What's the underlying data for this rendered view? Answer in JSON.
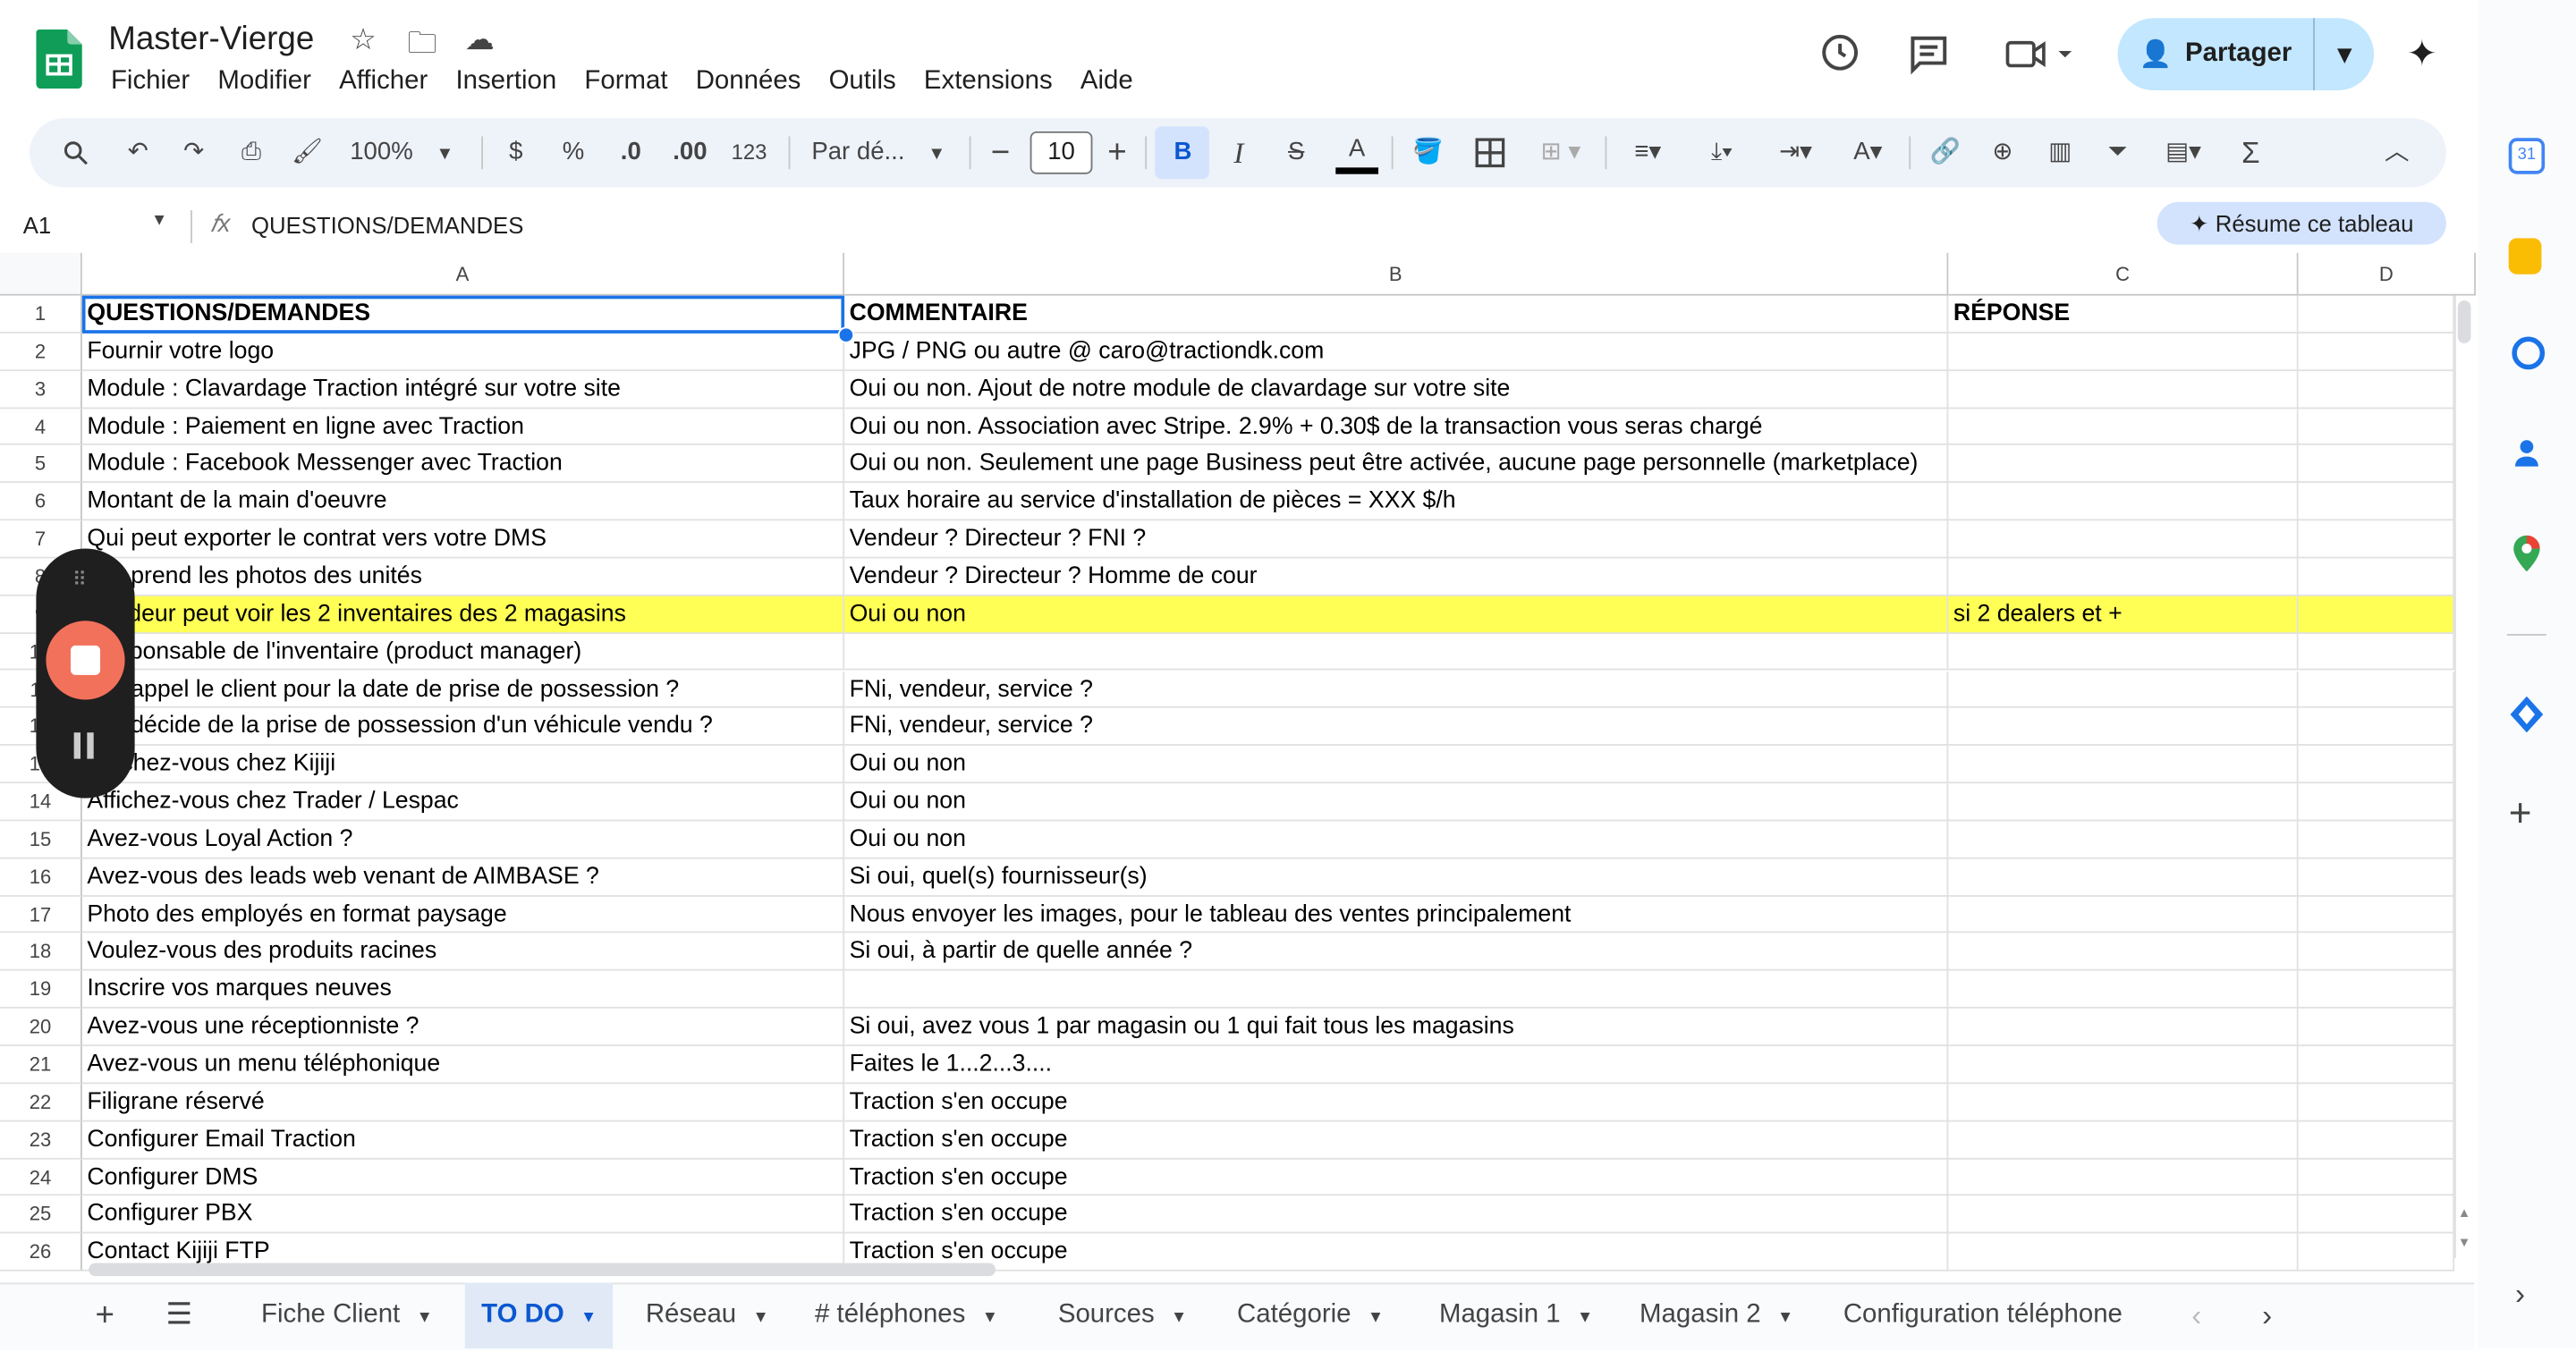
{
  "app": {
    "doc_title": "Master-Vierge",
    "menu": [
      "Fichier",
      "Modifier",
      "Afficher",
      "Insertion",
      "Format",
      "Données",
      "Outils",
      "Extensions",
      "Aide"
    ],
    "share_label": "Partager"
  },
  "toolbar": {
    "zoom": "100%",
    "currency": "$",
    "percent": "%",
    "dec_minus": ".0",
    "dec_plus": ".00",
    "format_123": "123",
    "font": "Par dé...",
    "font_size": "10"
  },
  "formula_bar": {
    "cell_ref": "A1",
    "content": "QUESTIONS/DEMANDES",
    "summarize": "Résume ce tableau"
  },
  "columns": [
    "A",
    "B",
    "C",
    "D"
  ],
  "rows": [
    {
      "n": "1",
      "a": "QUESTIONS/DEMANDES",
      "b": "COMMENTAIRE",
      "c": "RÉPONSE"
    },
    {
      "n": "2",
      "a": "Fournir votre logo",
      "b": "JPG / PNG ou autre @ caro@tractiondk.com",
      "c": ""
    },
    {
      "n": "3",
      "a": "Module : Clavardage Traction intégré sur votre site",
      "b": "Oui ou non. Ajout de notre module de clavardage sur votre site",
      "c": ""
    },
    {
      "n": "4",
      "a": "Module : Paiement en ligne avec Traction",
      "b": "Oui ou non. Association avec Stripe. 2.9% + 0.30$ de la transaction vous seras chargé",
      "c": ""
    },
    {
      "n": "5",
      "a": "Module : Facebook Messenger avec Traction",
      "b": "Oui ou non. Seulement une page Business peut être activée, aucune page personnelle (marketplace)",
      "c": ""
    },
    {
      "n": "6",
      "a": "Montant de la main d'oeuvre",
      "b": "Taux horaire au service d'installation de pièces = XXX $/h",
      "c": ""
    },
    {
      "n": "7",
      "a": "Qui peut exporter le contrat vers votre DMS",
      "b": "Vendeur ? Directeur ? FNI ?",
      "c": ""
    },
    {
      "n": "8",
      "a": "Qui prend les photos des unités",
      "b": "Vendeur ? Directeur ? Homme de cour",
      "c": ""
    },
    {
      "n": "9",
      "a": "Vendeur peut voir les 2 inventaires des 2 magasins",
      "b": "Oui ou non",
      "c": "si 2 dealers et +"
    },
    {
      "n": "10",
      "a": "Responsable de l'inventaire (product manager)",
      "b": "",
      "c": ""
    },
    {
      "n": "11",
      "a": "Qui appel le client pour la date de prise de possession ?",
      "b": "FNi, vendeur, service ?",
      "c": ""
    },
    {
      "n": "12",
      "a": "Qui décide de la prise de possession d'un véhicule vendu ?",
      "b": "FNi, vendeur, service ?",
      "c": ""
    },
    {
      "n": "13",
      "a": "Affichez-vous chez Kijiji",
      "b": "Oui ou non",
      "c": ""
    },
    {
      "n": "14",
      "a": "Affichez-vous chez Trader / Lespac",
      "b": "Oui ou non",
      "c": ""
    },
    {
      "n": "15",
      "a": "Avez-vous Loyal Action ?",
      "b": "Oui ou non",
      "c": ""
    },
    {
      "n": "16",
      "a": "Avez-vous des leads web venant de AIMBASE ?",
      "b": "Si oui, quel(s) fournisseur(s)",
      "c": ""
    },
    {
      "n": "17",
      "a": "Photo des employés en format paysage",
      "b": "Nous envoyer les images, pour le tableau des ventes principalement",
      "c": ""
    },
    {
      "n": "18",
      "a": "Voulez-vous des produits racines",
      "b": "Si oui, à partir de quelle année ?",
      "c": ""
    },
    {
      "n": "19",
      "a": "Inscrire vos marques neuves",
      "b": "",
      "c": ""
    },
    {
      "n": "20",
      "a": "Avez-vous une réceptionniste ?",
      "b": "Si oui, avez vous 1 par magasin ou 1 qui fait tous les magasins",
      "c": ""
    },
    {
      "n": "21",
      "a": "Avez-vous un menu téléphonique",
      "b": "Faites le 1...2...3....",
      "c": ""
    },
    {
      "n": "22",
      "a": "Filigrane réservé",
      "b": "Traction s'en occupe",
      "c": ""
    },
    {
      "n": "23",
      "a": "Configurer Email Traction",
      "b": "Traction s'en occupe",
      "c": ""
    },
    {
      "n": "24",
      "a": "Configurer DMS",
      "b": "Traction s'en occupe",
      "c": ""
    },
    {
      "n": "25",
      "a": "Configurer PBX",
      "b": "Traction s'en occupe",
      "c": ""
    },
    {
      "n": "26",
      "a": "Contact Kijiji FTP",
      "b": "Traction s'en occupe",
      "c": ""
    }
  ],
  "sheet_tabs": [
    "Fiche Client",
    "TO DO",
    "Réseau",
    "# téléphones",
    "Sources",
    "Catégorie",
    "Magasin 1",
    "Magasin 2",
    "Configuration téléphone"
  ],
  "active_tab": "TO DO",
  "colors": {
    "accent": "#0b57d0",
    "highlight_row": "#ffff55",
    "share_bg": "#c2e7ff"
  }
}
